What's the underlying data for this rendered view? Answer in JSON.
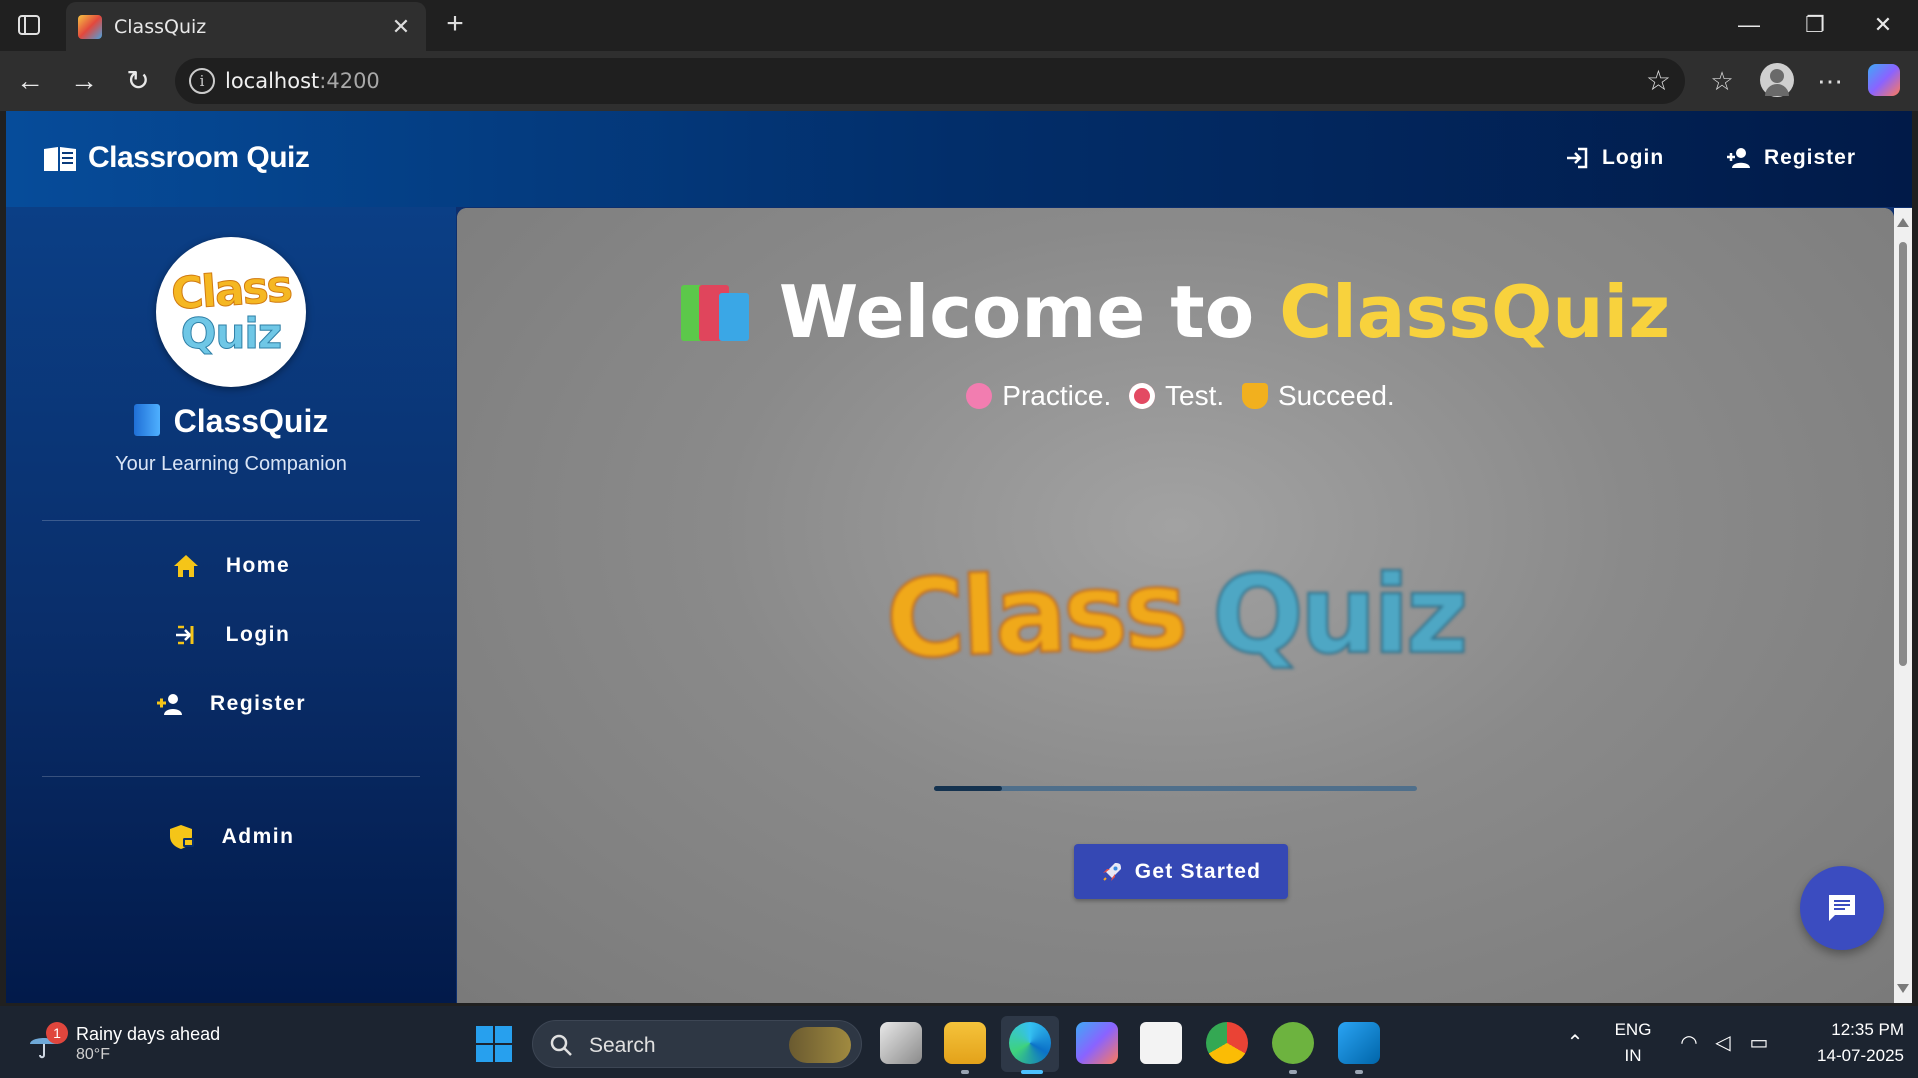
{
  "browser": {
    "tab_title": "ClassQuiz",
    "url_host": "localhost",
    "url_port": ":4200"
  },
  "header": {
    "brand": "Classroom Quiz",
    "login": "Login",
    "register": "Register"
  },
  "sidebar": {
    "logo_line1": "Class",
    "logo_line2": "Quiz",
    "title": "ClassQuiz",
    "subtitle": "Your Learning Companion",
    "items": [
      {
        "label": "Home",
        "icon": "home-icon"
      },
      {
        "label": "Login",
        "icon": "login-icon"
      },
      {
        "label": "Register",
        "icon": "user-plus-icon"
      }
    ],
    "admin": {
      "label": "Admin",
      "icon": "shield-lock-icon"
    }
  },
  "main": {
    "welcome_prefix": "Welcome to ",
    "welcome_highlight": "ClassQuiz",
    "tagline": {
      "practice": "Practice.",
      "test": "Test.",
      "succeed": "Succeed."
    },
    "logo_word1": "Class",
    "logo_word2": "Quiz",
    "loading_progress": 0.14,
    "cta_label": "Get Started"
  },
  "taskbar": {
    "weather_title": "Rainy days ahead",
    "weather_temp": "80°F",
    "weather_badge": "1",
    "search_label": "Search",
    "lang_top": "ENG",
    "lang_bottom": "IN",
    "time": "12:35 PM",
    "date": "14-07-2025"
  },
  "colors": {
    "accent_yellow": "#f8d23d",
    "cta_blue": "#3548b4",
    "header_blue": "#022e6a"
  }
}
